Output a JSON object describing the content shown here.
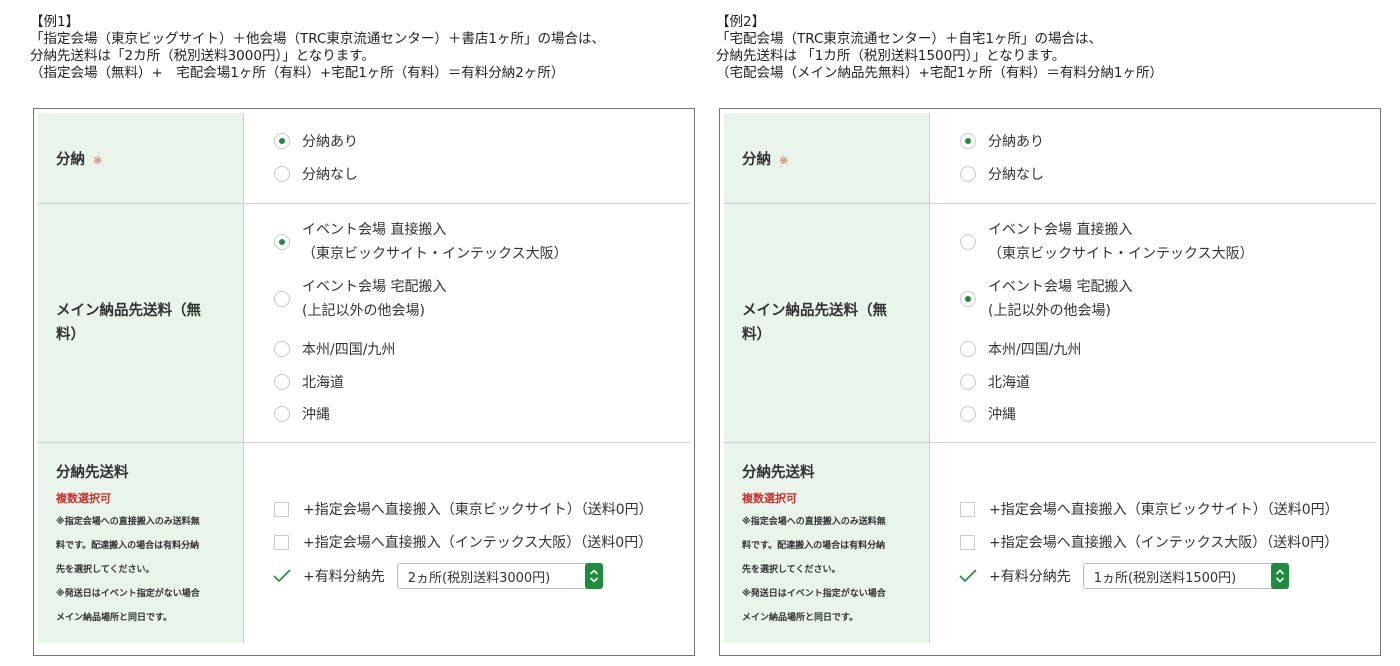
{
  "example1": {
    "heading": "【例1】",
    "line1": "「指定会場（東京ビッグサイト）＋他会場（TRC東京流通センター）＋書店1ヶ所」の場合は、",
    "line2": "分納先送料は「2カ所（税別送料3000円）」となります。",
    "line3": "（指定会場（無料）+　宅配会場1ヶ所（有料）+宅配1ヶ所（有料）＝有料分納2ヶ所）",
    "bunno_label": "分納",
    "required_mark": "※",
    "bunno_options": [
      "分納あり",
      "分納なし"
    ],
    "bunno_selected": 0,
    "main_label": "メイン納品先送料（無料）",
    "main_options": [
      {
        "l1": "イベント会場 直接搬入",
        "l2": "（東京ビックサイト・インテックス大阪）"
      },
      {
        "l1": "イベント会場 宅配搬入",
        "l2": "(上記以外の他会場)"
      },
      {
        "l1": "本州/四国/九州"
      },
      {
        "l1": "北海道"
      },
      {
        "l1": "沖縄"
      }
    ],
    "main_selected": 0,
    "ship_label": "分納先送料",
    "multi": "複数選択可",
    "note1a": "※指定会場への直接搬入のみ送料無",
    "note1b": "料です。配達搬入の場合は有料分納",
    "note1c": "先を選択してください。",
    "note2a": "※発送日はイベント指定がない場合",
    "note2b": "メイン納品場所と同日です。",
    "check1": "+指定会場へ直接搬入（東京ビックサイト）（送料0円）",
    "check2": "+指定会場へ直接搬入（インテックス大阪）（送料0円）",
    "paid_label": "+有料分納先",
    "paid_select": "2ヵ所(税別送料3000円)"
  },
  "example2": {
    "heading": "【例2】",
    "line1": "「宅配会場（TRC東京流通センター）＋自宅1ヶ所」の場合は、",
    "line2": "分納先送料は 「1カ所（税別送料1500円）」となります。",
    "line3": "（宅配会場（メイン納品先無料）+宅配1ヶ所（有料）＝有料分納1ヶ所）",
    "bunno_label": "分納",
    "required_mark": "※",
    "bunno_options": [
      "分納あり",
      "分納なし"
    ],
    "bunno_selected": 0,
    "main_label": "メイン納品先送料（無料）",
    "main_options": [
      {
        "l1": "イベント会場 直接搬入",
        "l2": "（東京ビックサイト・インテックス大阪）"
      },
      {
        "l1": "イベント会場 宅配搬入",
        "l2": "(上記以外の他会場)"
      },
      {
        "l1": "本州/四国/九州"
      },
      {
        "l1": "北海道"
      },
      {
        "l1": "沖縄"
      }
    ],
    "main_selected": 1,
    "ship_label": "分納先送料",
    "multi": "複数選択可",
    "note1a": "※指定会場への直接搬入のみ送料無",
    "note1b": "料です。配達搬入の場合は有料分納",
    "note1c": "先を選択してください。",
    "note2a": "※発送日はイベント指定がない場合",
    "note2b": "メイン納品場所と同日です。",
    "check1": "+指定会場へ直接搬入（東京ビックサイト）（送料0円）",
    "check2": "+指定会場へ直接搬入（インテックス大阪）（送料0円）",
    "paid_label": "+有料分納先",
    "paid_select": "1ヵ所(税別送料1500円)"
  }
}
